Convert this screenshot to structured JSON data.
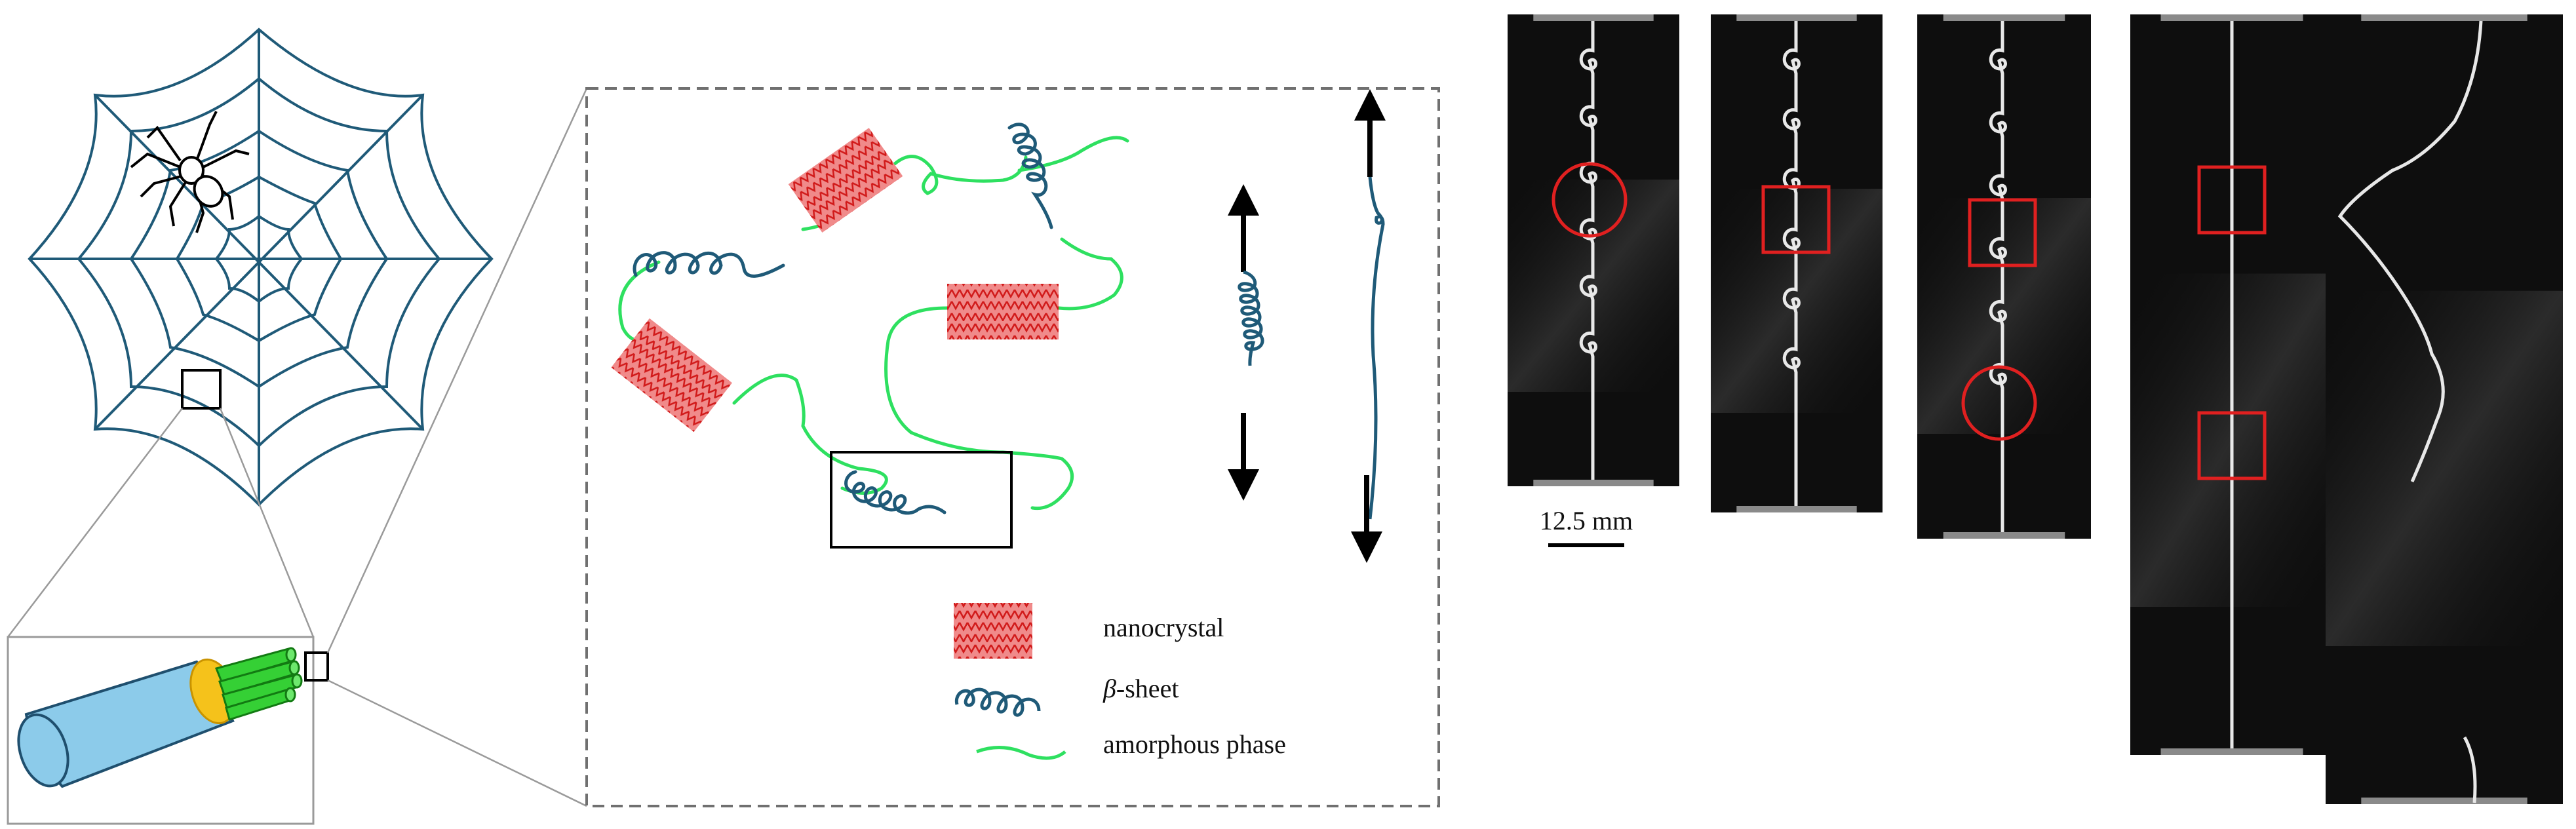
{
  "colors": {
    "web": "#1f5a78",
    "beta_sheet": "#1f5a78",
    "amorphous": "#2ee060",
    "nanocrystal_fill": "#f08a8a",
    "nanocrystal_zigzag": "#d11a1a",
    "fiber_outer": "#8ccbea",
    "fiber_core": "#f5c21b",
    "fibril": "#35d035",
    "photo_bg": "#0e0e0e",
    "marker_red": "#e02020"
  },
  "legend": {
    "nanocrystal": "nanocrystal",
    "beta_sheet_symbol": "β",
    "beta_sheet_suffix": "-sheet",
    "amorphous": "amorphous phase"
  },
  "scale_bar": {
    "label": "12.5 mm"
  },
  "icons": [
    "spider-icon",
    "spider-web-icon",
    "fiber-bundle-icon",
    "arrow-up-icon",
    "arrow-down-icon"
  ],
  "photos": [
    {
      "id": "specimen-1",
      "loops": 6,
      "markers": [
        "circle"
      ]
    },
    {
      "id": "specimen-2",
      "loops": 6,
      "markers": [
        "square"
      ]
    },
    {
      "id": "specimen-3",
      "loops": 6,
      "markers": [
        "square",
        "circle"
      ]
    },
    {
      "id": "specimen-4",
      "loops": 0,
      "markers": [
        "square",
        "square"
      ]
    },
    {
      "id": "specimen-5",
      "loops": 0,
      "markers": []
    }
  ]
}
